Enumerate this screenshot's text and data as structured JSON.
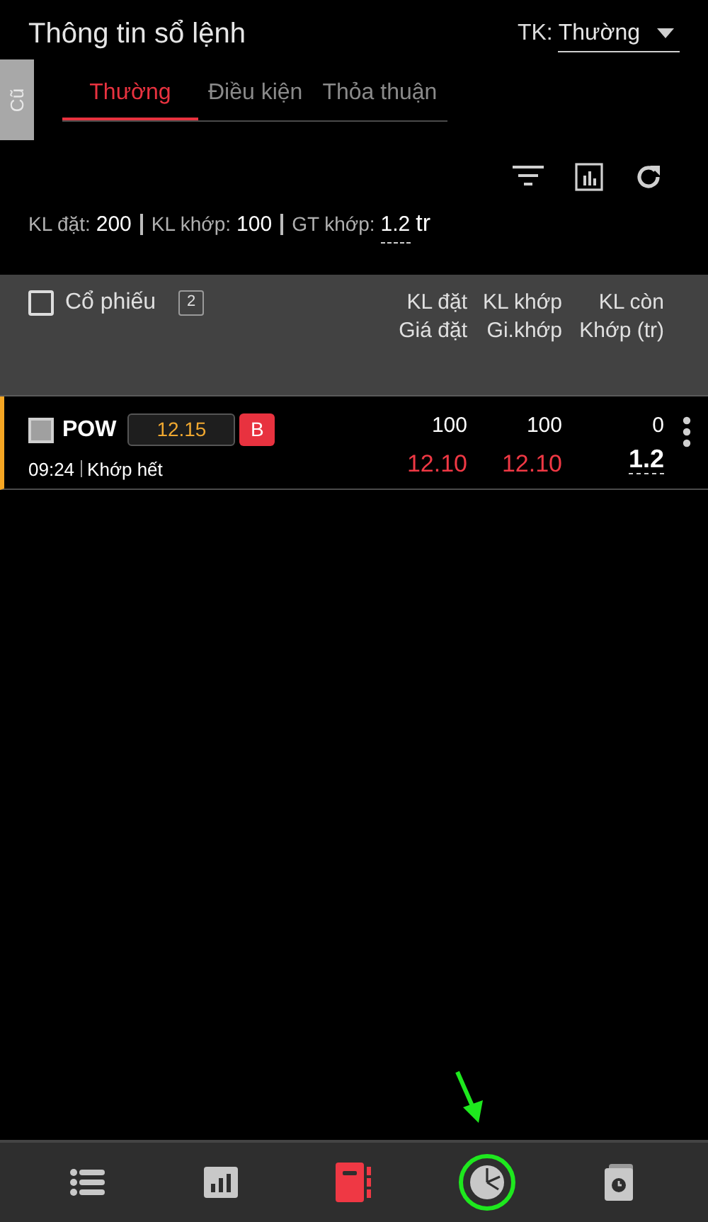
{
  "header": {
    "title": "Thông tin sổ lệnh",
    "account_label": "TK:",
    "account_value": "Thường"
  },
  "side_tab": {
    "label": "Cũ"
  },
  "tabs": [
    {
      "label": "Thường",
      "selected": true
    },
    {
      "label": "Điều kiện",
      "selected": false
    },
    {
      "label": "Thỏa thuận",
      "selected": false
    }
  ],
  "summary": {
    "ordered_label": "KL đặt:",
    "ordered": "200",
    "matched_label": "KL khớp:",
    "matched": "100",
    "value_label": "GT khớp:",
    "value": "1.2",
    "value_unit": "tr"
  },
  "table": {
    "select_all": {
      "checked": false
    },
    "columns": [
      "Cổ phiếu",
      "KL đặt\nGiá đặt",
      "KL khớp\nGi.khớp",
      "KL còn\nKhớp (tr)"
    ],
    "count": "2",
    "rows": [
      {
        "symbol": "POW",
        "checked": false,
        "ref_price": "12.15",
        "side": "B",
        "time": "09:24",
        "status": "Khớp hết",
        "ordered_qty": "100",
        "order_price": "12.10",
        "matched_qty": "100",
        "matched_price": "12.10",
        "remaining_qty": "0",
        "matched_value": "1.2"
      }
    ]
  },
  "nav": [
    {
      "kind": "list",
      "selected": false,
      "annotated": false
    },
    {
      "kind": "chart",
      "selected": false,
      "annotated": false
    },
    {
      "kind": "book",
      "selected": true,
      "annotated": false
    },
    {
      "kind": "pie",
      "selected": false,
      "annotated": true
    },
    {
      "kind": "history",
      "selected": false,
      "annotated": false
    }
  ]
}
